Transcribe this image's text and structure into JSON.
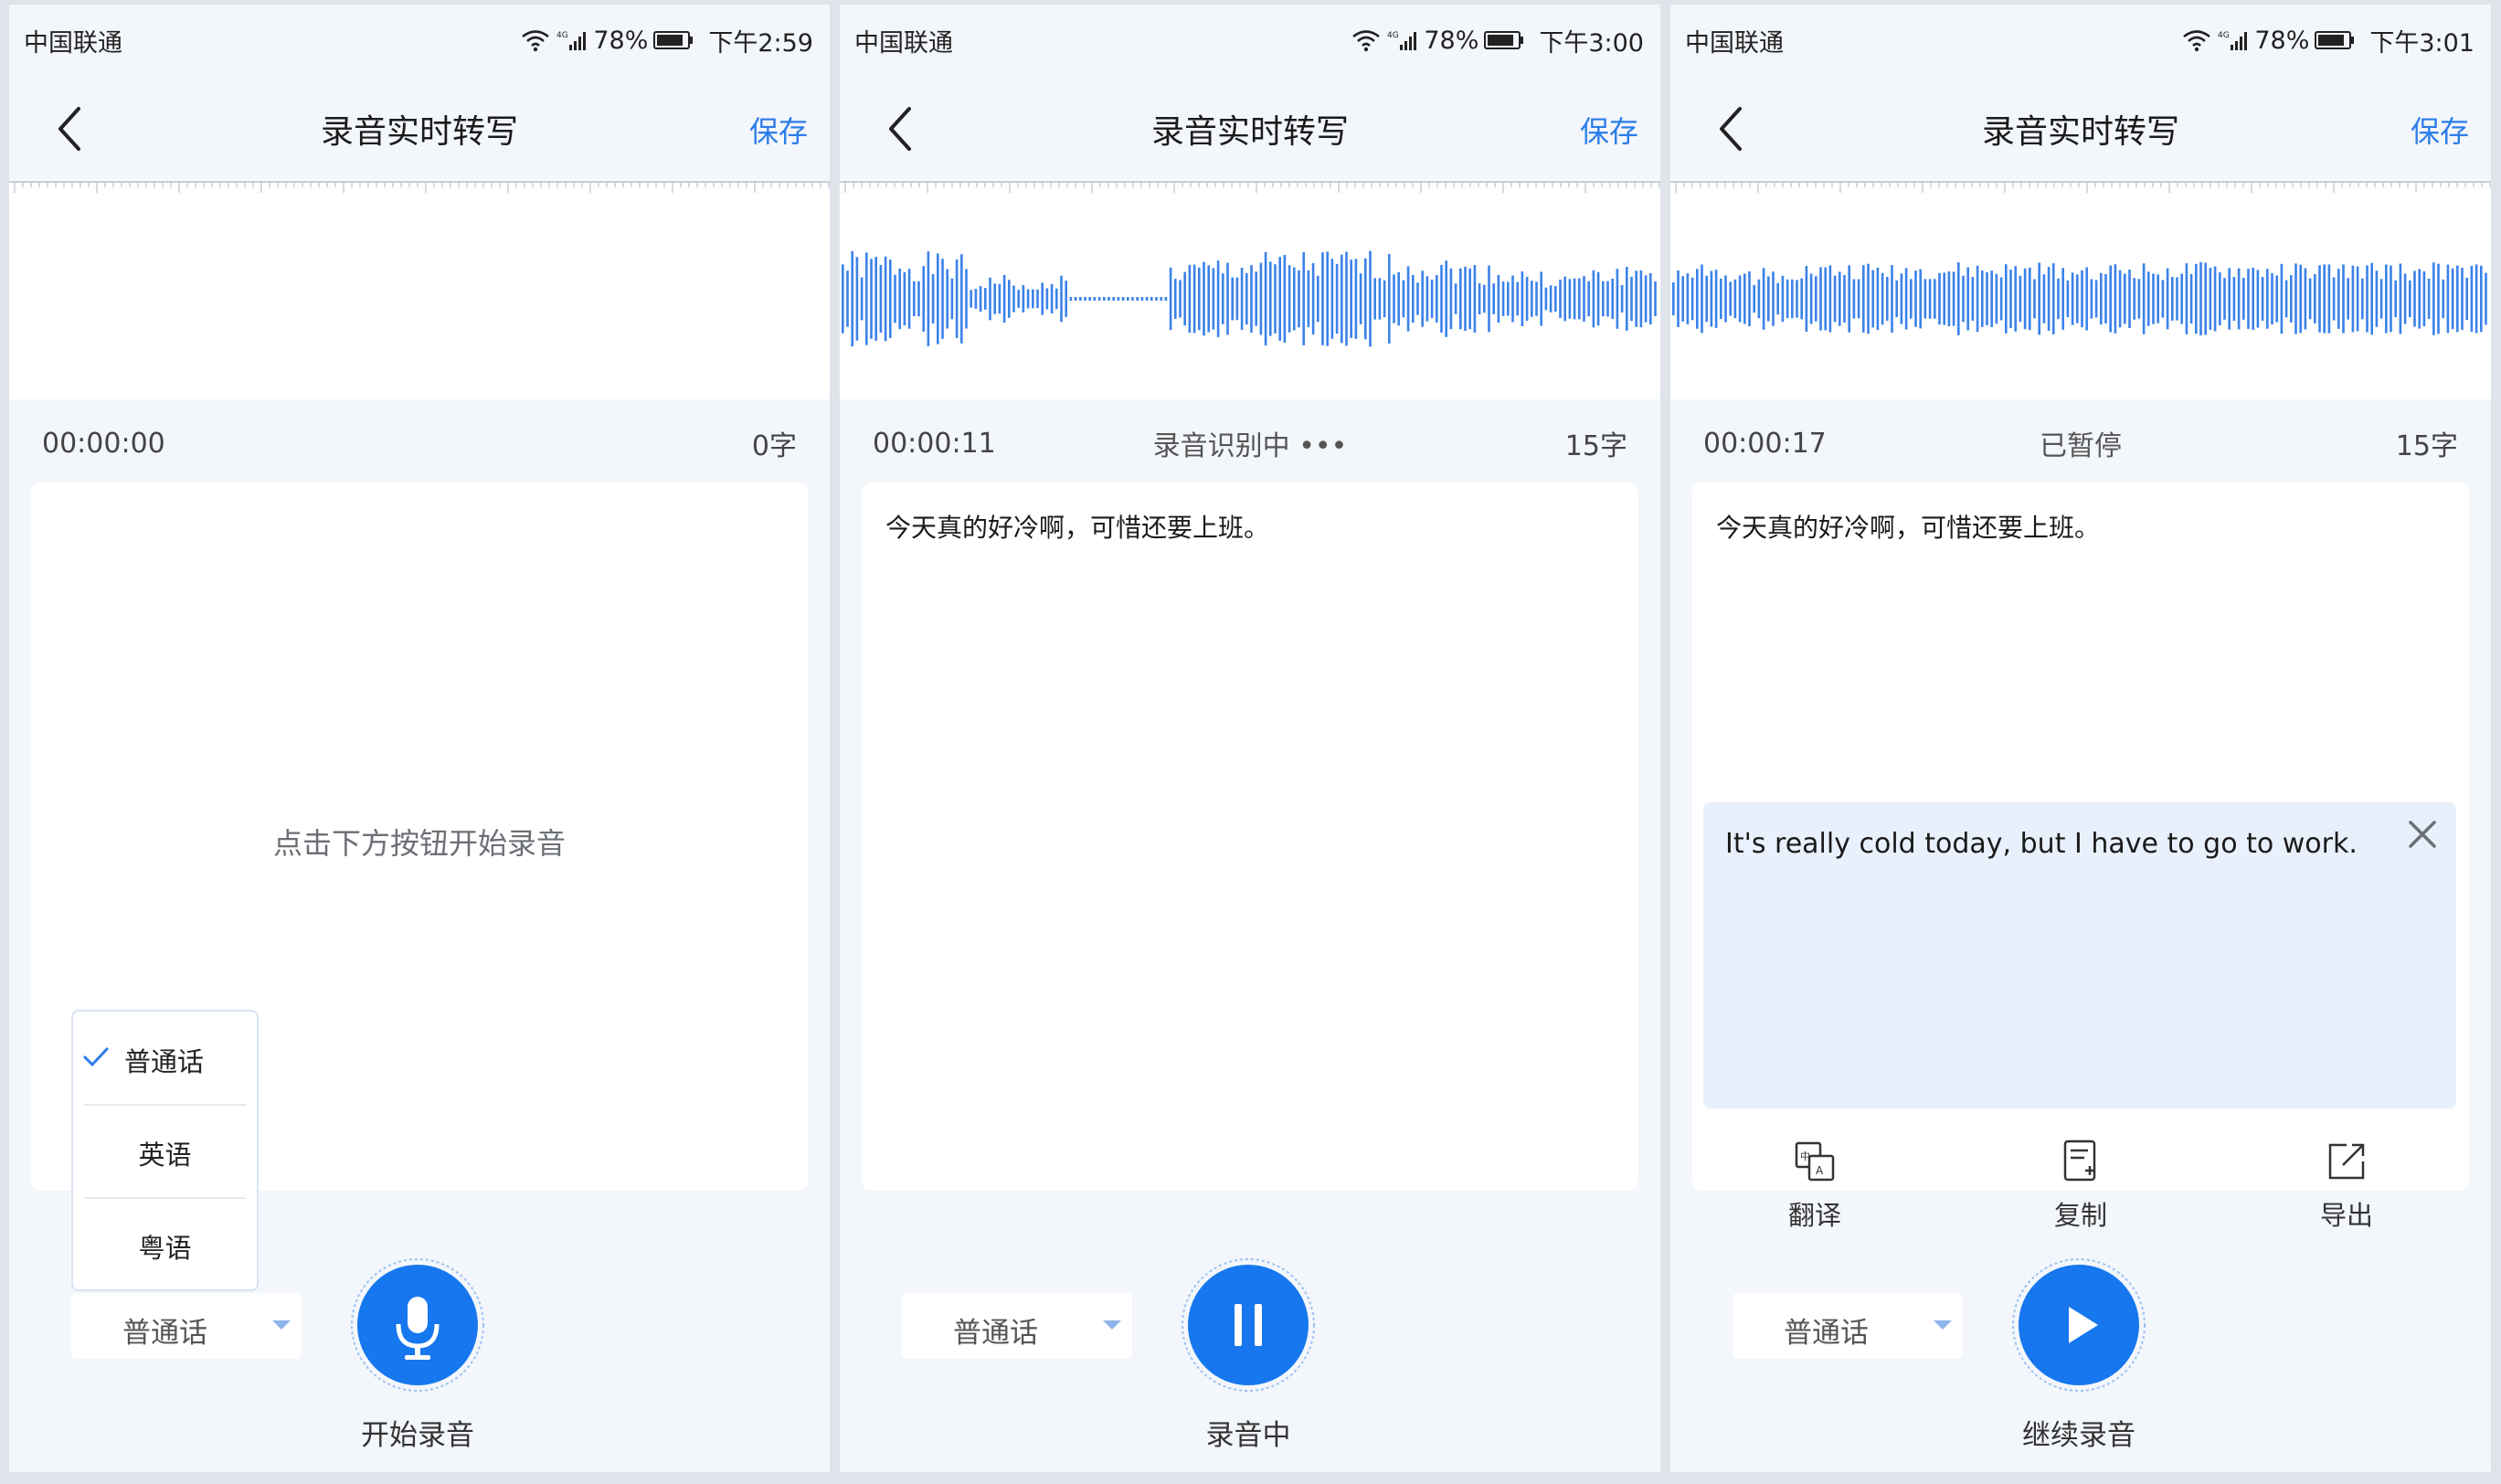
{
  "screens": [
    {
      "status_bar": {
        "carrier": "中国联通",
        "battery": "78%",
        "time": "下午2:59"
      },
      "header": {
        "title": "录音实时转写",
        "save_label": "保存"
      },
      "info": {
        "time": "00:00:00",
        "status": "",
        "count": "0字"
      },
      "card": {
        "placeholder": "点击下方按钮开始录音"
      },
      "language": {
        "selected": "普通话",
        "menu": [
          {
            "label": "普通话",
            "checked": true
          },
          {
            "label": "英语"
          },
          {
            "label": "粤语"
          }
        ]
      },
      "record_button": {
        "label": "开始录音",
        "icon": "mic-icon"
      }
    },
    {
      "status_bar": {
        "carrier": "中国联通",
        "battery": "78%",
        "time": "下午3:00"
      },
      "header": {
        "title": "录音实时转写",
        "save_label": "保存"
      },
      "info": {
        "time": "00:00:11",
        "status": "录音识别中 •••",
        "count": "15字"
      },
      "card": {
        "text": "今天真的好冷啊，可惜还要上班。"
      },
      "language": {
        "selected": "普通话"
      },
      "record_button": {
        "label": "录音中",
        "icon": "pause-icon"
      }
    },
    {
      "status_bar": {
        "carrier": "中国联通",
        "battery": "78%",
        "time": "下午3:01"
      },
      "header": {
        "title": "录音实时转写",
        "save_label": "保存"
      },
      "info": {
        "time": "00:00:17",
        "status": "已暂停",
        "count": "15字"
      },
      "card": {
        "text": "今天真的好冷啊，可惜还要上班。",
        "translation": "It's really cold today, but I have to go to work."
      },
      "actions": [
        {
          "label": "翻译",
          "icon": "translate-icon"
        },
        {
          "label": "复制",
          "icon": "copy-icon"
        },
        {
          "label": "导出",
          "icon": "export-icon"
        }
      ],
      "language": {
        "selected": "普通话"
      },
      "record_button": {
        "label": "继续录音",
        "icon": "play-icon"
      }
    }
  ],
  "colors": {
    "accent": "#2b7de9",
    "wave": "#3b82e8",
    "background": "#f3f6fb",
    "translation_bg": "#e8f0fb"
  }
}
